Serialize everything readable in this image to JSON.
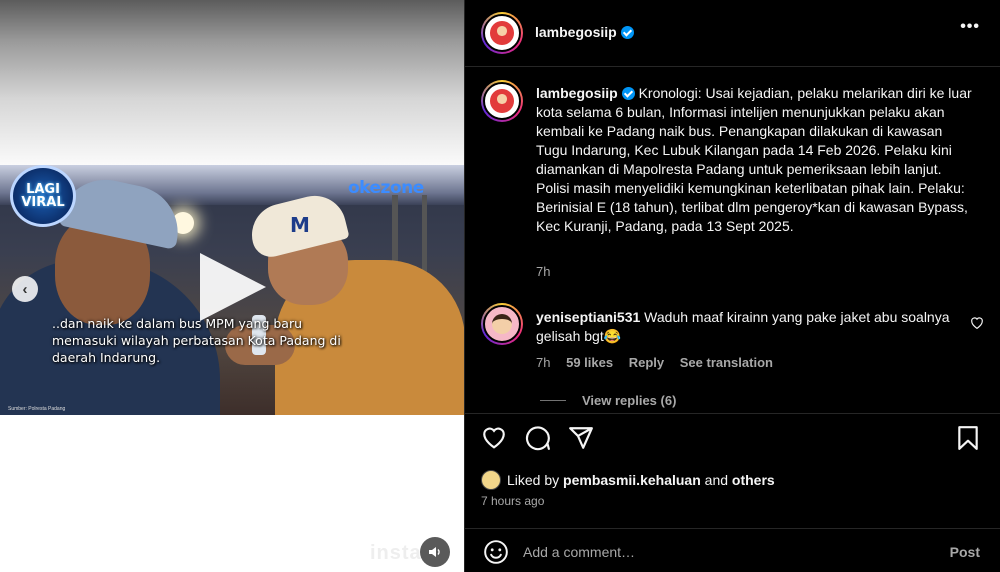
{
  "media": {
    "badge_line1": "LAGI",
    "badge_line2": "VIRAL",
    "channel_logo": "okezone",
    "caption": "..dan naik ke dalam bus MPM yang baru memasuki wilayah perbatasan Kota Padang di daerah Indarung.",
    "source_label": "Sumber: Polresta Padang",
    "watermark": "insta",
    "prev_icon": "chevron-left-icon",
    "play_icon": "play-icon",
    "mute_icon": "speaker-icon"
  },
  "header": {
    "username": "lambegosiip",
    "more_icon": "more-horizontal-icon",
    "more_label": "•••"
  },
  "post": {
    "username": "lambegosiip",
    "text": "Kronologi: Usai kejadian, pelaku melarikan diri ke luar kota selama 6 bulan, Informasi intelijen menunjukkan pelaku akan kembali ke Padang naik bus. Penangkapan dilakukan di kawasan Tugu Indarung, Kec Lubuk Kilangan pada 14 Feb 2026. Pelaku kini diamankan di Mapolresta Padang untuk pemeriksaan lebih lanjut. Polisi masih menyelidiki kemungkinan keterlibatan pihak lain. Pelaku: Berinisial E (18 tahun), terlibat dlm pengeroy*kan di kawasan Bypass, Kec Kuranji, Padang, pada 13 Sept 2025.",
    "time": "7h"
  },
  "comment": {
    "username": "yeniseptiani531",
    "text": "Waduh maaf kirainn yang pake jaket abu soalnya gelisah bgt😂",
    "time": "7h",
    "likes": "59 likes",
    "reply_label": "Reply",
    "translate_label": "See translation",
    "view_replies": "View replies (6)"
  },
  "actions": {
    "like_icon": "heart-icon",
    "comment_icon": "comment-icon",
    "share_icon": "share-icon",
    "save_icon": "bookmark-icon"
  },
  "likes": {
    "prefix": "Liked by ",
    "user": "pembasmii.kehaluan",
    "middle": " and ",
    "others": "others",
    "age": "7 hours ago"
  },
  "add_comment": {
    "placeholder": "Add a comment…",
    "post_label": "Post",
    "emoji_icon": "emoji-icon"
  },
  "colors": {
    "verified": "#0095f6",
    "background": "#000000",
    "secondary_text": "#a8a8a8"
  }
}
